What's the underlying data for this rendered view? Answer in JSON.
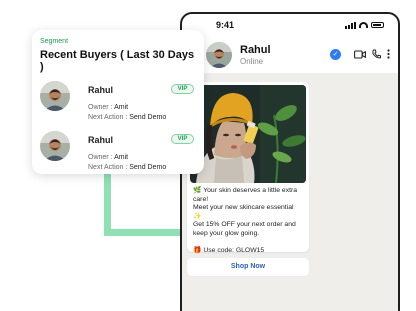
{
  "segment": {
    "label": "Segment",
    "title": "Recent Buyers ( Last 30 Days )",
    "buyers": [
      {
        "name": "Rahul",
        "badge": "VIP",
        "owner_label": "Owner :",
        "owner": "Amit",
        "action_label": "Next Action :",
        "action": "Send Demo"
      },
      {
        "name": "Rahul",
        "badge": "VIP",
        "owner_label": "Owner :",
        "owner": "Amit",
        "action_label": "Next Action :",
        "action": "Send Demo"
      }
    ]
  },
  "phone": {
    "status_time": "9:41",
    "contact": {
      "name": "Rahul",
      "status": "Online"
    },
    "message": {
      "lines": [
        "🌿 Your skin deserves a little extra care!",
        "Meet your new skincare essential ✨",
        " Get 15% OFF your next order and keep your glow going.",
        "",
        "🎁 Use code: GLOW15"
      ],
      "button": "Shop Now"
    }
  },
  "colors": {
    "accent_green": "#1f9a4f",
    "connector": "#8fe0b2",
    "link_blue": "#2a5fbf",
    "verified_blue": "#2f7bf5",
    "chat_bg": "#efeeeb"
  },
  "icons": [
    "signal-icon",
    "wifi-icon",
    "battery-icon",
    "verified-icon",
    "video-call-icon",
    "phone-call-icon",
    "more-icon"
  ]
}
